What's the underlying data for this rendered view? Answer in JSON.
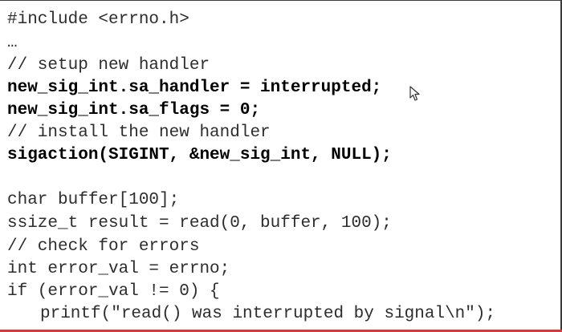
{
  "code": {
    "lines": [
      {
        "text": "#include <errno.h>",
        "bold": false
      },
      {
        "text": "…",
        "bold": false
      },
      {
        "text": "// setup new handler",
        "bold": false
      },
      {
        "text": "new_sig_int.sa_handler = interrupted;",
        "bold": true
      },
      {
        "text": "new_sig_int.sa_flags = 0;",
        "bold": true
      },
      {
        "text": "// install the new handler",
        "bold": false
      },
      {
        "text": "sigaction(SIGINT, &new_sig_int, NULL);",
        "bold": true
      },
      {
        "text": "",
        "bold": false
      },
      {
        "text": "char buffer[100];",
        "bold": false
      },
      {
        "text": "ssize_t result = read(0, buffer, 100);",
        "bold": false
      },
      {
        "text": "// check for errors",
        "bold": false
      },
      {
        "text": "int error_val = errno;",
        "bold": false
      },
      {
        "text": "if (error_val != 0) {",
        "bold": false
      },
      {
        "text": "printf(\"read() was interrupted by signal\\n\");",
        "bold": false
      }
    ]
  },
  "colors": {
    "text": "#2d2d2d",
    "bold_text": "#000000",
    "bottom_rule": "#d63a3a"
  },
  "cursor": {
    "icon": "mouse-pointer-icon"
  }
}
